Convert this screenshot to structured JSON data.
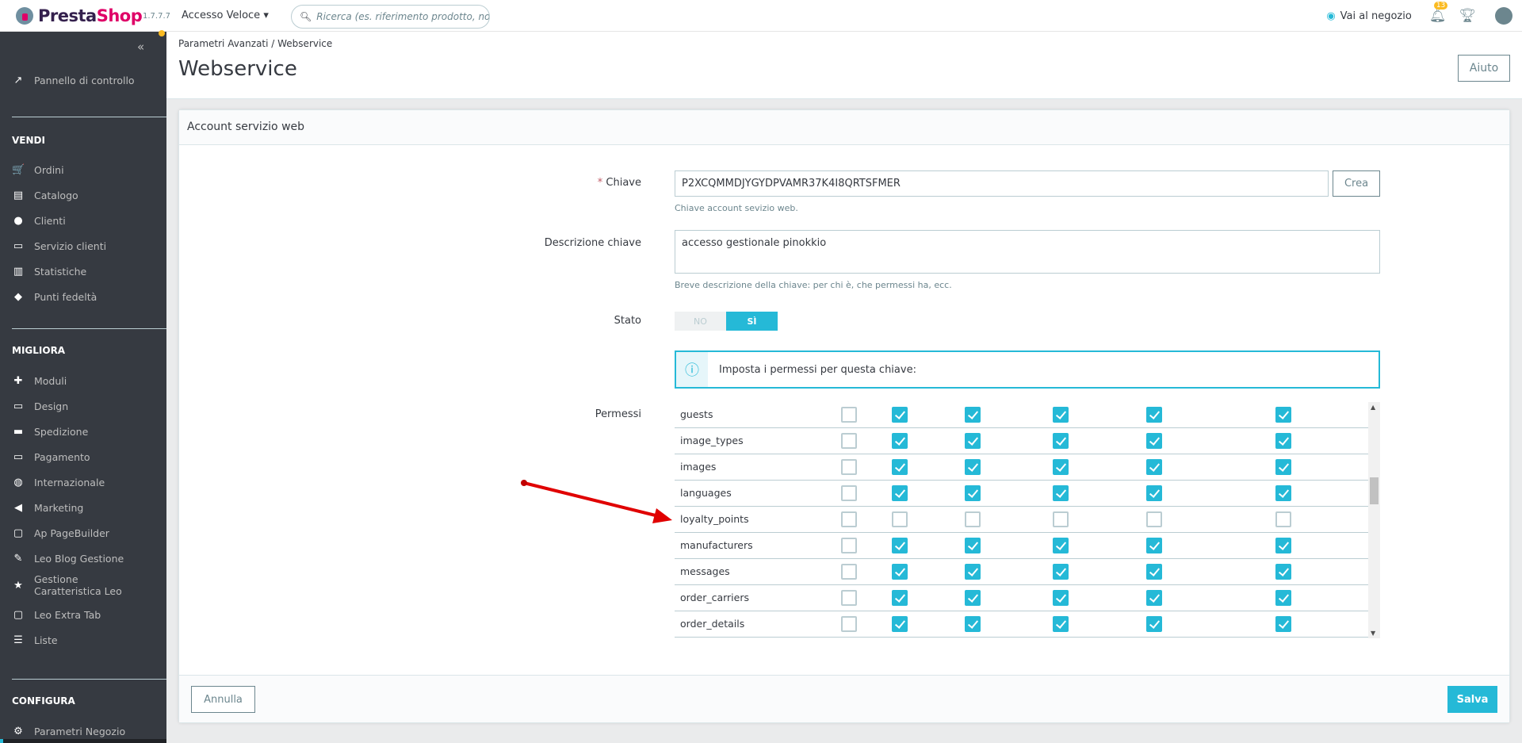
{
  "topbar": {
    "brand_a": "Presta",
    "brand_b": "Shop",
    "version": "1.7.7.7",
    "quick_access": "Accesso Veloce",
    "search_placeholder": "Ricerca (es. riferimento prodotto, nome",
    "view_shop": "Vai al negozio",
    "notifications": "13"
  },
  "sidebar": {
    "dashboard": "Pannello di controllo",
    "sections": [
      {
        "title": "VENDI",
        "items": [
          "Ordini",
          "Catalogo",
          "Clienti",
          "Servizio clienti",
          "Statistiche",
          "Punti fedeltà"
        ]
      },
      {
        "title": "MIGLIORA",
        "items": [
          "Moduli",
          "Design",
          "Spedizione",
          "Pagamento",
          "Internazionale",
          "Marketing",
          "Ap PageBuilder",
          "Leo Blog Gestione",
          "Gestione Caratteristica Leo",
          "Leo Extra Tab",
          "Liste"
        ]
      },
      {
        "title": "CONFIGURA",
        "items": [
          "Parametri Negozio"
        ]
      }
    ]
  },
  "header": {
    "breadcrumb_parent": "Parametri Avanzati",
    "breadcrumb_current": "Webservice",
    "title": "Webservice",
    "help": "Aiuto"
  },
  "panel": {
    "title": "Account servizio web",
    "key_label": "Chiave",
    "key_value": "P2XCQMMDJYGYDPVAMR37K4I8QRTSFMER",
    "key_help": "Chiave account sevizio web.",
    "generate": "Crea",
    "desc_label": "Descrizione chiave",
    "desc_value": "accesso gestionale pinokkio",
    "desc_help": "Breve descrizione della chiave: per chi è, che permessi ha, ecc.",
    "status_label": "Stato",
    "status_no": "NO",
    "status_yes": "SÌ",
    "status_value": "yes",
    "info": "Imposta i permessi per questa chiave:",
    "perm_label": "Permessi",
    "permissions": [
      {
        "name": "guests",
        "checks": [
          false,
          true,
          true,
          true,
          true,
          true
        ]
      },
      {
        "name": "image_types",
        "checks": [
          false,
          true,
          true,
          true,
          true,
          true
        ]
      },
      {
        "name": "images",
        "checks": [
          false,
          true,
          true,
          true,
          true,
          true
        ]
      },
      {
        "name": "languages",
        "checks": [
          false,
          true,
          true,
          true,
          true,
          true
        ]
      },
      {
        "name": "loyalty_points",
        "checks": [
          false,
          false,
          false,
          false,
          false,
          false
        ]
      },
      {
        "name": "manufacturers",
        "checks": [
          false,
          true,
          true,
          true,
          true,
          true
        ]
      },
      {
        "name": "messages",
        "checks": [
          false,
          true,
          true,
          true,
          true,
          true
        ]
      },
      {
        "name": "order_carriers",
        "checks": [
          false,
          true,
          true,
          true,
          true,
          true
        ]
      },
      {
        "name": "order_details",
        "checks": [
          false,
          true,
          true,
          true,
          true,
          true
        ]
      }
    ],
    "cancel": "Annulla",
    "save": "Salva"
  },
  "colors": {
    "accent": "#25b9d7",
    "sidebar": "#363a41",
    "annotation_arrow": "#e00000"
  }
}
